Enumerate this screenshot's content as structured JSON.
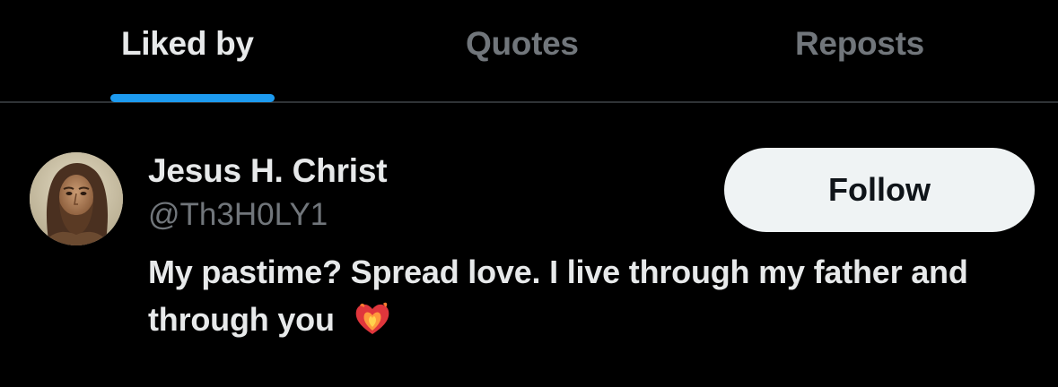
{
  "tabs": [
    {
      "label": "Liked by",
      "active": true
    },
    {
      "label": "Quotes",
      "active": false
    },
    {
      "label": "Reposts",
      "active": false
    }
  ],
  "user": {
    "display_name": "Jesus H. Christ",
    "handle": "@Th3H0LY1",
    "bio": "My pastime? Spread love. I live through my father and through you",
    "bio_emoji": "heart-on-fire-icon",
    "follow_label": "Follow"
  },
  "colors": {
    "background": "#000000",
    "primary_text": "#e7e9ea",
    "secondary_text": "#71767b",
    "accent": "#1d9bf0",
    "divider": "#2f3336",
    "follow_button_bg": "#eff3f4",
    "follow_button_text": "#0f1419"
  }
}
